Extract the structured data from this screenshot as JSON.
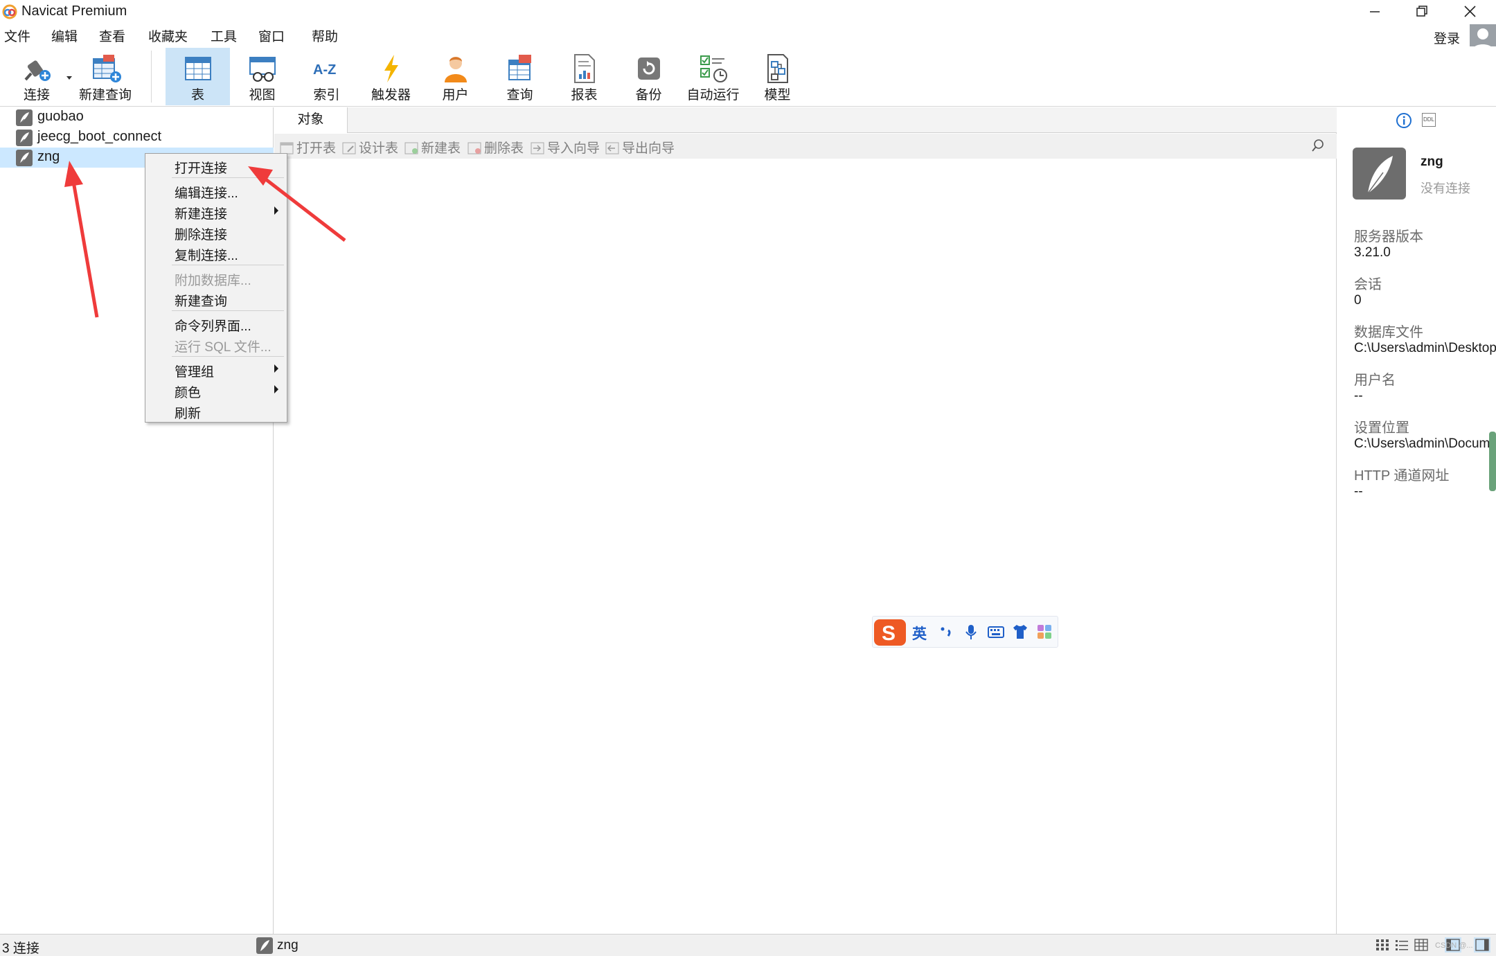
{
  "window": {
    "title": "Navicat Premium"
  },
  "menubar": {
    "items": [
      "文件",
      "编辑",
      "查看",
      "收藏夹",
      "工具",
      "窗口",
      "帮助"
    ],
    "login": "登录"
  },
  "toolbar": {
    "connect": "连接",
    "new_query": "新建查询",
    "table": "表",
    "view": "视图",
    "index": "索引",
    "trigger": "触发器",
    "user": "用户",
    "query": "查询",
    "report": "报表",
    "backup": "备份",
    "autorun": "自动运行",
    "model": "模型",
    "active": "表"
  },
  "navigator": {
    "connections": [
      {
        "name": "guobao",
        "selected": false
      },
      {
        "name": "jeecg_boot_connect",
        "selected": false
      },
      {
        "name": "zng",
        "selected": true
      }
    ]
  },
  "main": {
    "tab": "对象",
    "object_toolbar": [
      "打开表",
      "设计表",
      "新建表",
      "删除表",
      "导入向导",
      "导出向导"
    ]
  },
  "context_menu": {
    "items": [
      {
        "label": "打开连接",
        "disabled": false,
        "submenu": false
      },
      {
        "label": "编辑连接...",
        "disabled": false,
        "submenu": false
      },
      {
        "label": "新建连接",
        "disabled": false,
        "submenu": true
      },
      {
        "label": "删除连接",
        "disabled": false,
        "submenu": false
      },
      {
        "label": "复制连接...",
        "disabled": false,
        "submenu": false
      },
      {
        "label": "附加数据库...",
        "disabled": true,
        "submenu": false
      },
      {
        "label": "新建查询",
        "disabled": false,
        "submenu": false
      },
      {
        "label": "命令列界面...",
        "disabled": false,
        "submenu": false
      },
      {
        "label": "运行 SQL 文件...",
        "disabled": true,
        "submenu": false
      },
      {
        "label": "管理组",
        "disabled": false,
        "submenu": true
      },
      {
        "label": "颜色",
        "disabled": false,
        "submenu": true
      },
      {
        "label": "刷新",
        "disabled": false,
        "submenu": false
      }
    ]
  },
  "info_panel": {
    "header_icons": [
      "info-icon",
      "ddl-icon"
    ],
    "name": "zng",
    "status": "没有连接",
    "properties": [
      {
        "label": "服务器版本",
        "value": "3.21.0"
      },
      {
        "label": "会话",
        "value": "0"
      },
      {
        "label": "数据库文件",
        "value": "C:\\Users\\admin\\Desktop"
      },
      {
        "label": "用户名",
        "value": "--"
      },
      {
        "label": "设置位置",
        "value": "C:\\Users\\admin\\Documents"
      },
      {
        "label": "HTTP 通道网址",
        "value": "--"
      }
    ]
  },
  "statusbar": {
    "count": "3 连接",
    "current": "zng",
    "watermark": "CSDN @..."
  },
  "ime": {
    "lang": "英"
  },
  "colors": {
    "toolbar_active": "#cce4f7",
    "selected_row": "#cce8ff",
    "annotation_arrow": "#ef3b3b",
    "sogou_orange": "#ee5a24"
  }
}
